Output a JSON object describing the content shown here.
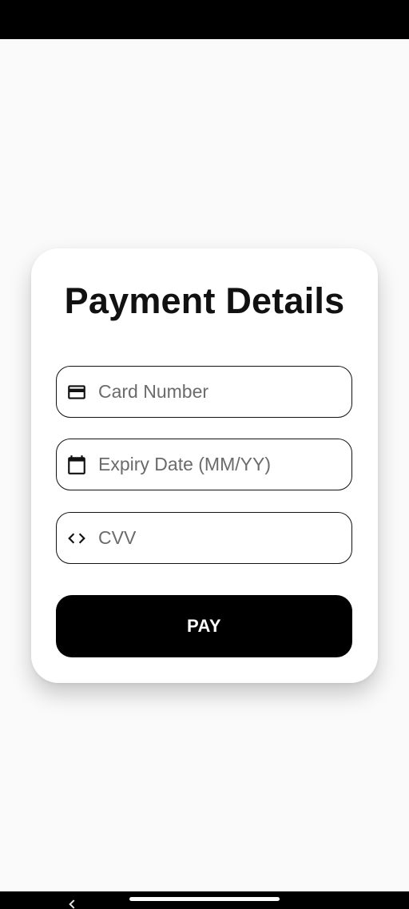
{
  "form": {
    "title": "Payment Details",
    "fields": [
      {
        "icon": "credit-card-icon",
        "placeholder": "Card Number",
        "value": ""
      },
      {
        "icon": "calendar-icon",
        "placeholder": "Expiry Date (MM/YY)",
        "value": ""
      },
      {
        "icon": "code-icon",
        "placeholder": "CVV",
        "value": ""
      }
    ],
    "pay_label": "PAY"
  },
  "colors": {
    "background": "#fafafa",
    "card": "#ffffff",
    "primary": "#000000",
    "text": "#111111",
    "placeholder": "#6b6b6b"
  }
}
